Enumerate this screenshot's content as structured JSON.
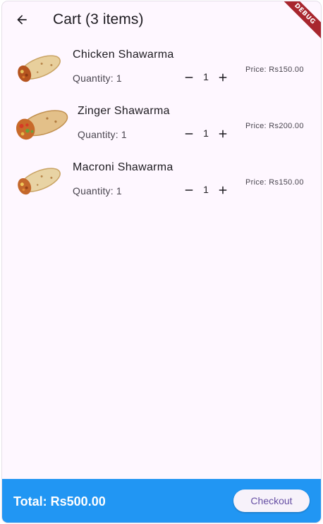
{
  "appbar": {
    "title": "Cart (3 items)",
    "debug_label": "DEBUG"
  },
  "items": [
    {
      "name": "Chicken Shawarma",
      "quantity_label": "Quantity: 1",
      "quantity": "1",
      "price_label": "Price: Rs150.00"
    },
    {
      "name": "Zinger Shawarma",
      "quantity_label": "Quantity: 1",
      "quantity": "1",
      "price_label": "Price: Rs200.00"
    },
    {
      "name": "Macroni Shawarma",
      "quantity_label": "Quantity: 1",
      "quantity": "1",
      "price_label": "Price: Rs150.00"
    }
  ],
  "footer": {
    "total_label": "Total: Rs500.00",
    "checkout_label": "Checkout"
  },
  "colors": {
    "background": "#fef7ff",
    "bottom_bar": "#2196f3",
    "checkout_text": "#6750a4",
    "debug_banner": "#a8262e"
  },
  "icons": {
    "back": "arrow-back-icon",
    "decrease": "minus-icon",
    "increase": "plus-icon"
  }
}
